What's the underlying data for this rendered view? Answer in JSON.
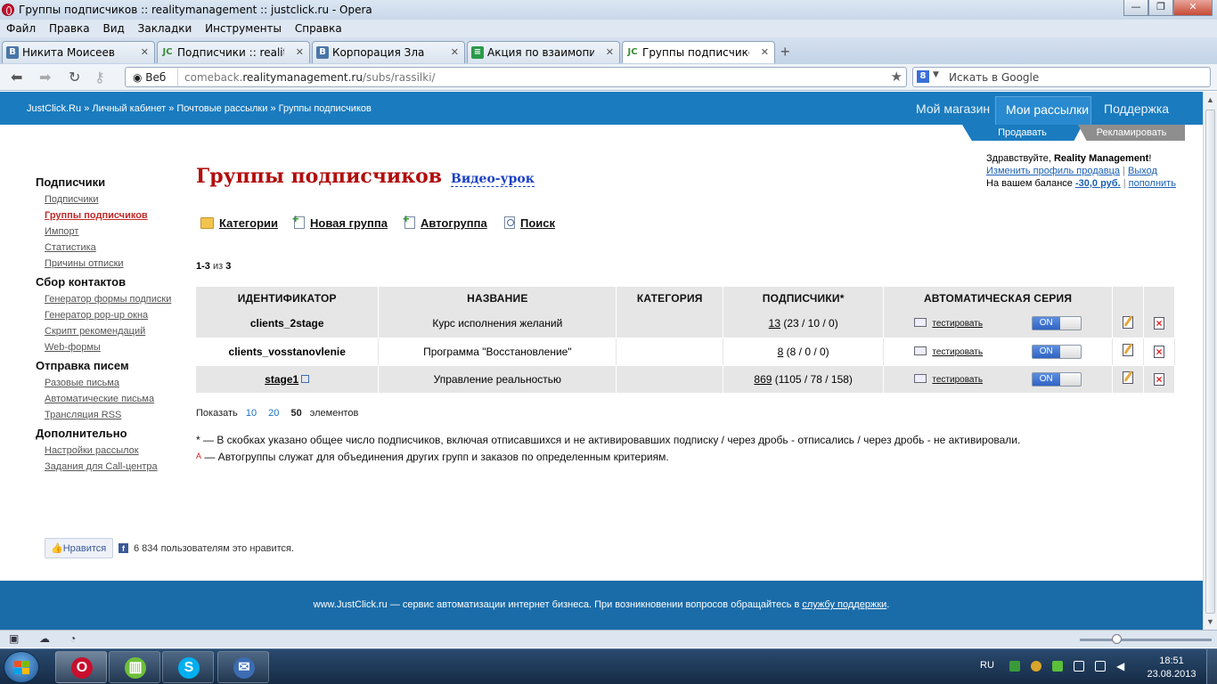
{
  "window": {
    "title": "Группы подписчиков :: realitymanagement :: justclick.ru - Opera"
  },
  "menu": [
    "Файл",
    "Правка",
    "Вид",
    "Закладки",
    "Инструменты",
    "Справка"
  ],
  "tabs": [
    {
      "label": "Никита Моисеев",
      "icon": "vk-icon"
    },
    {
      "label": "Подписчики :: reality.....",
      "icon": "jc-icon"
    },
    {
      "label": "Корпорация Зла",
      "icon": "vk-icon"
    },
    {
      "label": "Акция по взаимопиару",
      "icon": "sheet-icon"
    },
    {
      "label": "Группы подписчиков ...",
      "icon": "jc-icon",
      "active": true
    }
  ],
  "address": {
    "web_label": "Веб",
    "url_host": "comeback.",
    "url_domain": "realitymanagement.ru",
    "url_path": "/subs/rassilki/"
  },
  "search": {
    "placeholder": "Искать в Google",
    "engine_letter": "8"
  },
  "breadcrumb": {
    "items": [
      "JustClick.Ru",
      "Личный кабинет",
      "Почтовые рассылки",
      "Группы подписчиков"
    ],
    "sep": "»"
  },
  "topnav": {
    "shop": "Мой магазин",
    "mailings": "Мои рассылки",
    "support": "Поддержка",
    "sell": "Продавать",
    "advertise": "Рекламировать"
  },
  "greeting": {
    "hello": "Здравствуйте, ",
    "name": "Reality Management",
    "excl": "!",
    "edit_profile": "Изменить профиль продавца",
    "logout": "Выход",
    "balance_label": "На вашем балансе ",
    "balance": "-30,0 руб.",
    "topup": "пополнить",
    "pipe": "|"
  },
  "sidebar": [
    {
      "title": "Подписчики",
      "items": [
        "Подписчики",
        "Группы подписчиков",
        "Импорт",
        "Статистика",
        "Причины отписки"
      ],
      "current": 1
    },
    {
      "title": "Сбор контактов",
      "items": [
        "Генератор формы подписки",
        "Генератор pop-up окна",
        "Скрипт рекомендаций",
        "Web-формы"
      ]
    },
    {
      "title": "Отправка писем",
      "items": [
        "Разовые письма",
        "Автоматические письма",
        "Трансляция RSS"
      ]
    },
    {
      "title": "Дополнительно",
      "items": [
        "Настройки рассылок",
        "Задания для Call-центра"
      ]
    }
  ],
  "page": {
    "title": "Группы подписчиков",
    "video": "Видео-урок"
  },
  "actions": {
    "categories": "Категории",
    "new_group": "Новая группа",
    "autogroup": "Автогруппа",
    "search": "Поиск"
  },
  "pager": {
    "range": "1-3",
    "of": " из ",
    "total": "3"
  },
  "table": {
    "headers": [
      "ИДЕНТИФИКАТОР",
      "НАЗВАНИЕ",
      "КАТЕГОРИЯ",
      "ПОДПИСЧИКИ*",
      "АВТОМАТИЧЕСКАЯ СЕРИЯ",
      "",
      ""
    ],
    "test_label": "тестировать",
    "toggle_label": "ON",
    "rows": [
      {
        "id": "clients_2stage",
        "name": "Курс исполнения желаний",
        "category": "",
        "subs": "13",
        "subs_detail": " (23 / 10 / 0)"
      },
      {
        "id": "clients_vosstanovlenie",
        "name": "Программа \"Восстановление\"",
        "category": "",
        "subs": "8",
        "subs_detail": " (8 / 0 / 0)"
      },
      {
        "id": "stage1",
        "name": "Управление реальностью",
        "category": "",
        "subs": "869",
        "subs_detail": " (1105 / 78 / 158)",
        "link": true
      }
    ]
  },
  "show": {
    "label": "Показать",
    "opts": [
      "10",
      "20"
    ],
    "current": "50",
    "suffix": "элементов"
  },
  "notes": {
    "star": "* — В скобках указано общее число подписчиков, включая отписавшихся и не активировавших подписку / через дробь - отписались / через дробь - не активировали.",
    "auto_mark": "A",
    "auto": " — Автогруппы служат для объединения других групп и заказов по определенным критериям."
  },
  "like": {
    "button": "Нравится",
    "text": "6 834 пользователям это нравится."
  },
  "footer": {
    "text": "www.JustClick.ru — сервис автоматизации интернет бизнеса. При возникновении вопросов обращайтесь в ",
    "link": "службу поддержки",
    "end": "."
  },
  "taskbar": {
    "lang": "RU",
    "time": "18:51",
    "date": "23.08.2013"
  },
  "colors": {
    "brand_blue": "#1a7bbf",
    "title_red": "#b20d0d",
    "toggle_blue": "#2f63c4"
  }
}
